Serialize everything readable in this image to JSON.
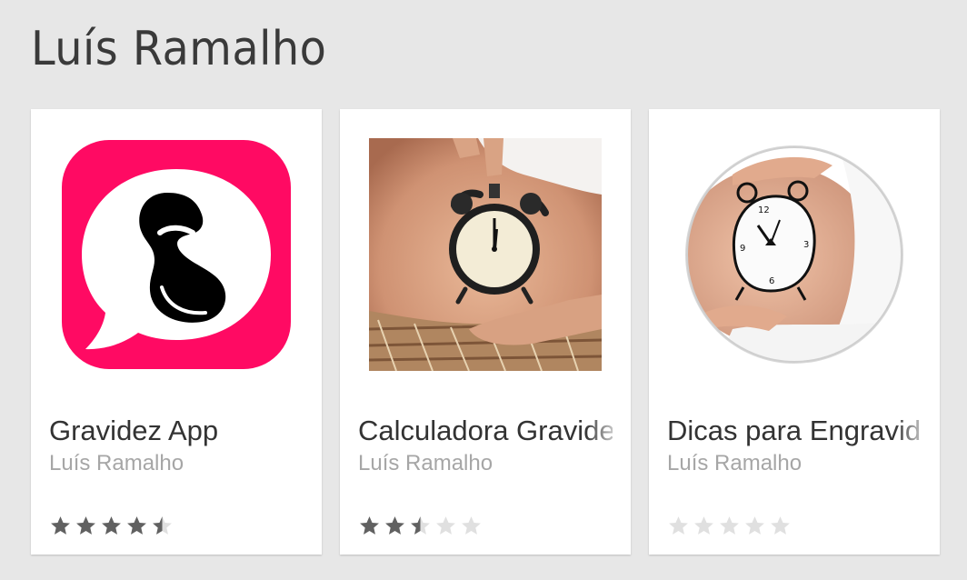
{
  "section": {
    "title": "Luís Ramalho"
  },
  "apps": [
    {
      "title": "Gravidez App",
      "author": "Luís Ramalho",
      "rating": 4.5,
      "icon": "pink-speech-bubble-fetus-icon",
      "accent": "#ff0a63"
    },
    {
      "title": "Calculadora Gravidez",
      "author": "Luís Ramalho",
      "rating": 2.5,
      "icon": "pregnant-belly-alarm-clock-photo"
    },
    {
      "title": "Dicas para Engravidar",
      "author": "Luís Ramalho",
      "rating": 0,
      "icon": "painted-clock-belly-circle-photo"
    }
  ],
  "colors": {
    "star_filled": "#616161",
    "star_empty": "#e0e0e0",
    "background": "#e7e7e7"
  }
}
